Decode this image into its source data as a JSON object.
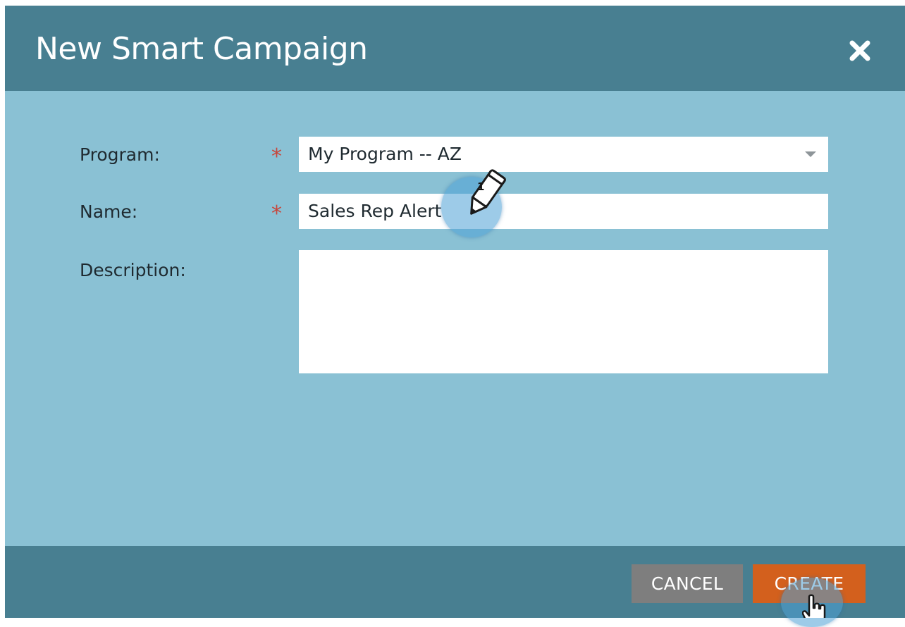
{
  "dialog": {
    "title": "New Smart Campaign",
    "close_icon": "close-icon"
  },
  "form": {
    "program": {
      "label": "Program:",
      "required_marker": "*",
      "selected_value": "My Program -- AZ",
      "icon": "chevron-down-icon"
    },
    "name": {
      "label": "Name:",
      "required_marker": "*",
      "value": "Sales Rep Alert"
    },
    "description": {
      "label": "Description:",
      "value": ""
    }
  },
  "footer": {
    "cancel_label": "CANCEL",
    "create_label": "CREATE"
  },
  "annotations": {
    "step_number": "1",
    "edit_cursor_icon": "pencil-cursor-icon",
    "click_cursor_icon": "hand-pointer-icon"
  },
  "colors": {
    "header": "#487f91",
    "body": "#8ac1d4",
    "create_button": "#d3601d",
    "cancel_button": "#7e7e7e",
    "required": "#c8453a"
  }
}
